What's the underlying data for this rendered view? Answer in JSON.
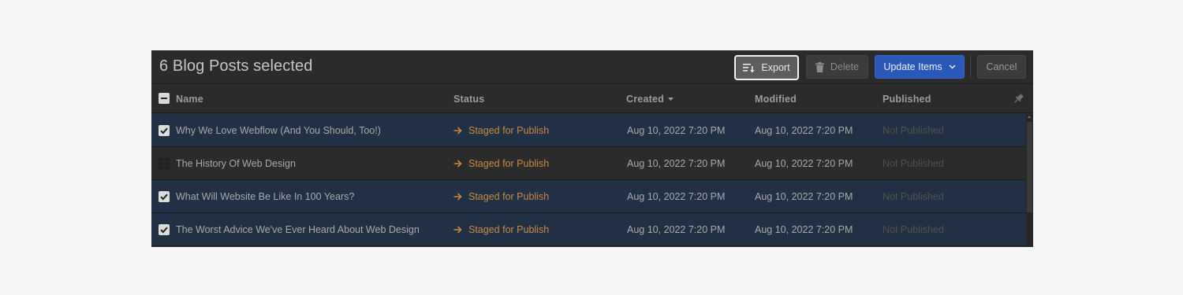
{
  "toolbar": {
    "title": "6 Blog Posts selected",
    "export_label": "Export",
    "delete_label": "Delete",
    "update_label": "Update Items",
    "cancel_label": "Cancel"
  },
  "table": {
    "columns": {
      "name": "Name",
      "status": "Status",
      "created": "Created",
      "modified": "Modified",
      "published": "Published"
    },
    "rows": [
      {
        "selected": true,
        "name": "Why We Love Webflow (And You Should, Too!)",
        "status": "Staged for Publish",
        "created": "Aug 10, 2022 7:20 PM",
        "modified": "Aug 10, 2022 7:20 PM",
        "published": "Not Published"
      },
      {
        "selected": false,
        "name": "The History Of Web Design",
        "status": "Staged for Publish",
        "created": "Aug 10, 2022 7:20 PM",
        "modified": "Aug 10, 2022 7:20 PM",
        "published": "Not Published"
      },
      {
        "selected": true,
        "name": "What Will Website Be Like In 100 Years?",
        "status": "Staged for Publish",
        "created": "Aug 10, 2022 7:20 PM",
        "modified": "Aug 10, 2022 7:20 PM",
        "published": "Not Published"
      },
      {
        "selected": true,
        "name": "The Worst Advice We've Ever Heard About Web Design",
        "status": "Staged for Publish",
        "created": "Aug 10, 2022 7:20 PM",
        "modified": "Aug 10, 2022 7:20 PM",
        "published": "Not Published"
      }
    ]
  },
  "icons": {
    "export": "export-list-icon",
    "delete": "trash-icon",
    "update": "chevron-down-icon",
    "sort": "sort-down-icon",
    "pin": "pin-icon",
    "status": "arrow-right-icon"
  },
  "colors": {
    "accent": "#2a58b8",
    "status": "#c98a42",
    "selected_row": "#223045"
  }
}
